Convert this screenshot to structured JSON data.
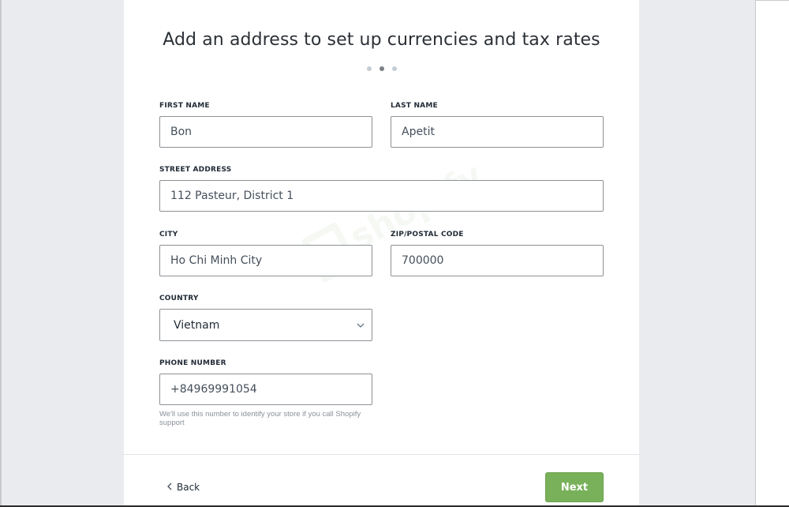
{
  "title": "Add an address to set up currencies and tax rates",
  "steps": {
    "count": 3,
    "active": 2
  },
  "watermark": "shopify",
  "form": {
    "first_name": {
      "label": "FIRST NAME",
      "value": "Bon"
    },
    "last_name": {
      "label": "LAST NAME",
      "value": "Apetit"
    },
    "street": {
      "label": "STREET ADDRESS",
      "value": "112 Pasteur, District 1"
    },
    "city": {
      "label": "CITY",
      "value": "Ho Chi Minh City"
    },
    "zip": {
      "label": "ZIP/POSTAL CODE",
      "value": "700000"
    },
    "country": {
      "label": "COUNTRY",
      "value": "Vietnam",
      "icon": "chevron-down-icon"
    },
    "phone": {
      "label": "PHONE NUMBER",
      "value": "+84969991054",
      "help": "We'll use this number to identify your store if you call Shopify support"
    }
  },
  "footer": {
    "back_label": "Back",
    "back_icon": "chevron-left-icon",
    "next_label": "Next"
  },
  "colors": {
    "accent": "#79b15b",
    "gutter": "#e9ebee"
  }
}
